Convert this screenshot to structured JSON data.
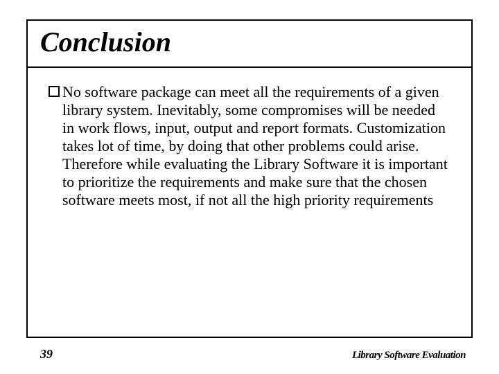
{
  "slide": {
    "title": "Conclusion",
    "bullet": "No software package can meet all the requirements of a given library system.  Inevitably, some compromises will be needed in work flows, input, output and report formats.  Customization takes lot of time, by doing that other problems could arise.  Therefore while evaluating the Library Software it is important to prioritize the requirements and make sure that the chosen software meets most, if not all the high priority requirements",
    "page_number": "39",
    "footer_title": "Library Software Evaluation"
  }
}
